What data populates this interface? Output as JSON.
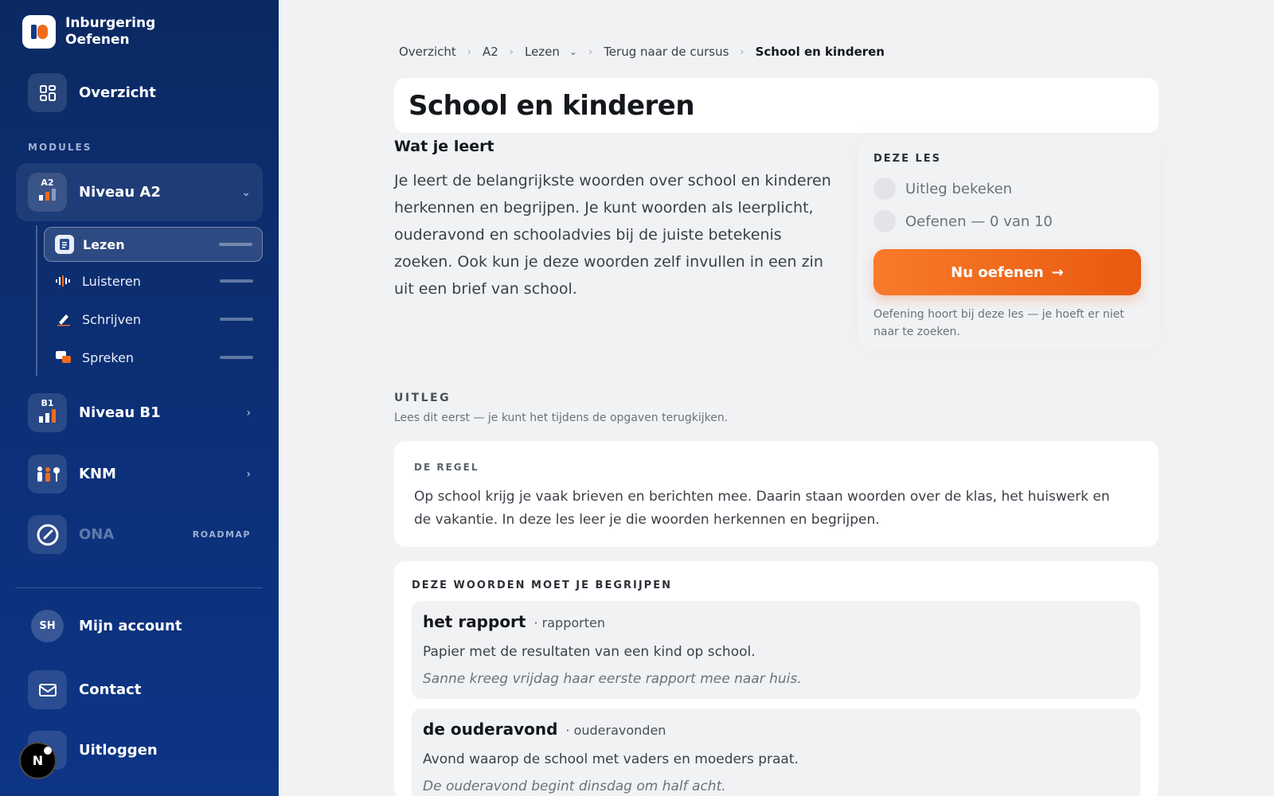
{
  "brand": {
    "line1": "Inburgering",
    "line2": "Oefenen"
  },
  "sidebar": {
    "overview_label": "Overzicht",
    "modules_label": "MODULES",
    "niveau_a2": {
      "badge": "A2",
      "label": "Niveau A2"
    },
    "sub_items": [
      {
        "label": "Lezen"
      },
      {
        "label": "Luisteren"
      },
      {
        "label": "Schrijven"
      },
      {
        "label": "Spreken"
      }
    ],
    "niveau_b1": {
      "badge": "B1",
      "label": "Niveau B1"
    },
    "knm": {
      "label": "KNM"
    },
    "ona": {
      "label": "ONA",
      "tag": "ROADMAP"
    },
    "account": {
      "initials": "SH",
      "label": "Mijn account"
    },
    "contact_label": "Contact",
    "logout_label": "Uitloggen",
    "dev_badge": "N"
  },
  "breadcrumb": {
    "items": [
      "Overzicht",
      "A2",
      "Lezen",
      "Terug naar de cursus"
    ],
    "current": "School en kinderen"
  },
  "page": {
    "title": "School en kinderen",
    "learn_title": "Wat je leert",
    "learn_body": "Je leert de belangrijkste woorden over school en kinderen herkennen en begrijpen. Je kunt woorden als leerplicht, ouderavond en schooladvies bij de juiste betekenis zoeken. Ook kun je deze woorden zelf invullen in een zin uit een brief van school."
  },
  "les_panel": {
    "label": "DEZE LES",
    "checks": [
      "Uitleg bekeken",
      "Oefenen — 0 van 10"
    ],
    "cta_label": "Nu oefenen",
    "cta_note": "Oefening hoort bij deze les — je hoeft er niet naar te zoeken."
  },
  "uitleg": {
    "label": "UITLEG",
    "sub": "Lees dit eerst — je kunt het tijdens de opgaven terugkijken."
  },
  "regel": {
    "label": "DE REGEL",
    "text": "Op school krijg je vaak brieven en berichten mee. Daarin staan woorden over de klas, het huiswerk en de vakantie. In deze les leer je die woorden herkennen en begrijpen."
  },
  "words": {
    "label": "DEZE WOORDEN MOET JE BEGRIJPEN",
    "items": [
      {
        "term": "het rapport",
        "plural": "· rapporten",
        "definition": "Papier met de resultaten van een kind op school.",
        "example": "Sanne kreeg vrijdag haar eerste rapport mee naar huis."
      },
      {
        "term": "de ouderavond",
        "plural": "· ouderavonden",
        "definition": "Avond waarop de school met vaders en moeders praat.",
        "example": "De ouderavond begint dinsdag om half acht."
      }
    ]
  },
  "colors": {
    "sidebar_bg": "#0b2a63",
    "accent_orange": "#f26b1d",
    "page_bg": "#f1f2f4"
  }
}
